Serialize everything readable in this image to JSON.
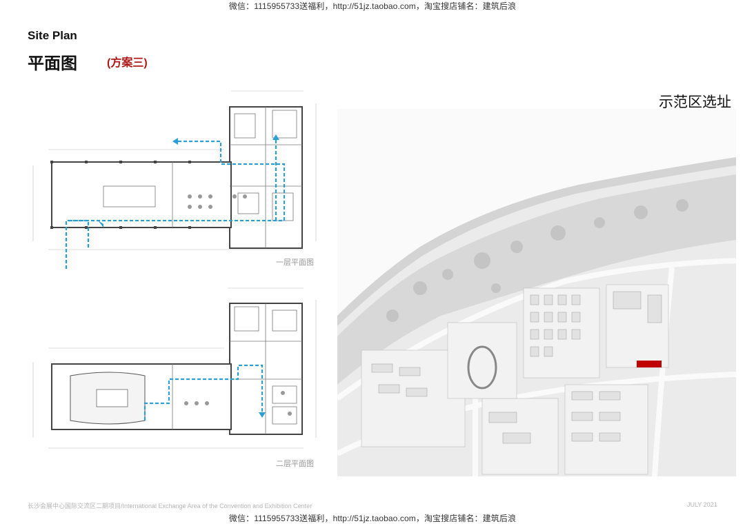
{
  "watermark": {
    "top": "微信：1115955733送福利，http://51jz.taobao.com，淘宝搜店铺名：建筑后浪",
    "bottom": "微信：1115955733送福利，http://51jz.taobao.com，淘宝搜店铺名：建筑后浪"
  },
  "header": {
    "title_en": "Site Plan",
    "title_zh": "平面图",
    "scheme": "(方案三)"
  },
  "plans": {
    "floor1_label": "一层平面图",
    "floor2_label": "二层平面图"
  },
  "site": {
    "title": "示范区选址",
    "marker_color": "#c00000"
  },
  "footer": {
    "project": "长沙会展中心国际交流区二期项目/International Exchange Area of the Convention and Exhibition Center",
    "date": "JULY 2021"
  },
  "colors": {
    "flow_arrow": "#2a9fd6",
    "wall": "#444444",
    "scheme_text": "#b01818"
  }
}
